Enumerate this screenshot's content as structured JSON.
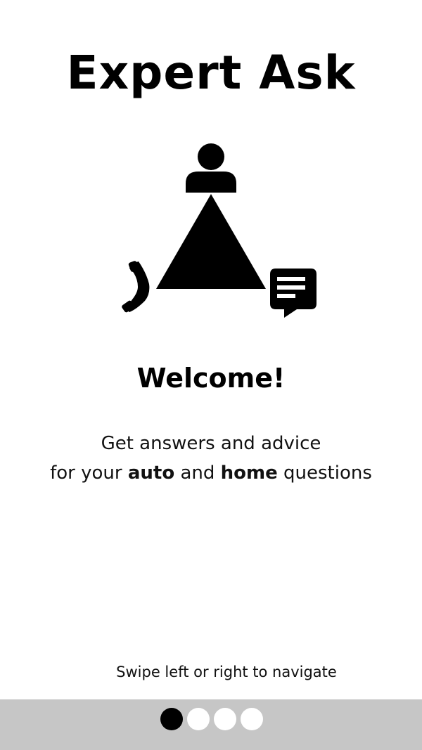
{
  "app": {
    "title": "Expert Ask"
  },
  "hero": {
    "icons": [
      "person-icon",
      "triangle-graphic",
      "phone-icon",
      "chat-icon"
    ]
  },
  "content": {
    "welcome": "Welcome!",
    "line1": "Get answers and advice",
    "line2_prefix": "for your ",
    "line2_auto": "auto",
    "line2_mid": " and ",
    "line2_home": "home",
    "line2_suffix": " questions"
  },
  "footer": {
    "hint": "Swipe left or right to navigate",
    "page_count": 4,
    "current_page": 1
  },
  "colors": {
    "background": "#ffffff",
    "text": "#000000",
    "pager_bar": "#c6c6c6",
    "dot_active": "#000000",
    "dot_inactive": "#ffffff"
  }
}
